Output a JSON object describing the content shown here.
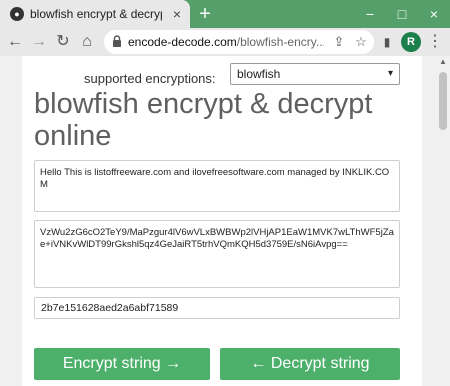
{
  "browser": {
    "tab": {
      "title": "blowfish encrypt & decrypt online",
      "close_icon": "×",
      "favicon_icon": "globe-icon"
    },
    "new_tab": "+",
    "window_controls": {
      "minimize": "−",
      "maximize": "□",
      "close": "×"
    },
    "toolbar": {
      "back": "←",
      "forward": "→",
      "reload": "↻",
      "home": "⌂",
      "url_host": "encode-decode.com",
      "url_path": "/blowfish-encry...",
      "share": "⇪",
      "bookmark": "☆",
      "sidepanel": "▮",
      "profile_initial": "R",
      "menu": "⋮"
    }
  },
  "page": {
    "supported_label": "supported encryptions:",
    "encryption_select": {
      "value": "blowfish",
      "chevron": "▾"
    },
    "heading": "blowfish encrypt & decrypt online",
    "plaintext": "Hello This is listoffreeware.com and ilovefreesoftware.com managed by INKLIK.COM",
    "ciphertext": "VzWu2zG6cO2TeY9/MaPzgur4lV6wVLxBWBWp2lVHjAP1EaW1MVK7wLThWF5jZae+iVNKvWlDT99rGkshl5qz4GeJaiRT5trhVQmKQH5d3759E/sN6iAvpg==",
    "key": "2b7e151628aed2a6abf71589",
    "encrypt_button": "Encrypt string →",
    "decrypt_button": "← Decrypt string"
  },
  "colors": {
    "accent": "#4caf6a",
    "chrome": "#55a06a"
  }
}
